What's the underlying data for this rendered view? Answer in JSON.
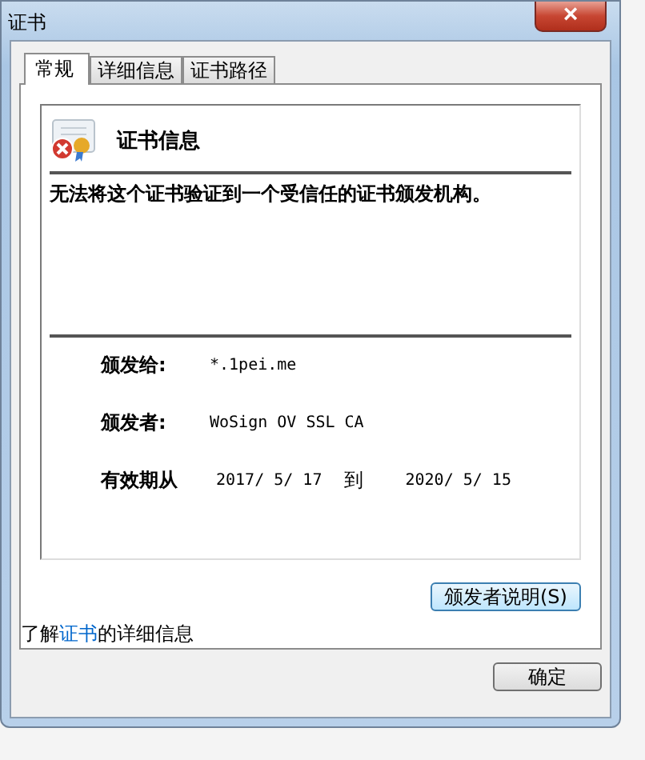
{
  "window": {
    "title": "证书",
    "close": "×"
  },
  "tabs": [
    {
      "label": "常规",
      "selected": true
    },
    {
      "label": "详细信息",
      "selected": false
    },
    {
      "label": "证书路径",
      "selected": false
    }
  ],
  "certificate": {
    "heading": "证书信息",
    "message": "无法将这个证书验证到一个受信任的证书颁发机构。",
    "fields": [
      {
        "label": "颁发给:",
        "value": "*.1pei.me"
      },
      {
        "label": "颁发者:",
        "value": "WoSign OV SSL CA"
      }
    ],
    "validity": {
      "label": "有效期从",
      "from": "2017/ 5/ 17",
      "to_label": "到",
      "to": "2020/ 5/ 15"
    }
  },
  "issuer_statement_button": "颁发者说明(S)",
  "learn_more": {
    "prefix": "了解",
    "link": "证书",
    "suffix": "的详细信息"
  },
  "buttons": [
    "确定"
  ]
}
